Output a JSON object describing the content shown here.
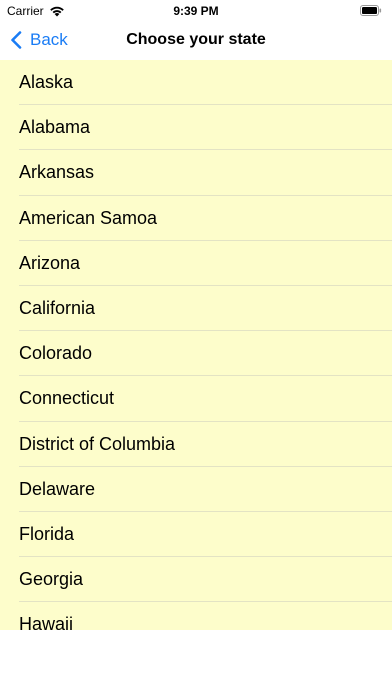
{
  "status_bar": {
    "carrier": "Carrier",
    "time": "9:39 PM",
    "wifi_icon": "wifi-icon",
    "battery_icon": "battery-icon"
  },
  "nav": {
    "back_label": "Back",
    "back_icon": "chevron-left-icon",
    "title": "Choose your state"
  },
  "colors": {
    "accent": "#1a7cf5",
    "list_background": "#fdfdcb"
  },
  "states": [
    "Alaska",
    "Alabama",
    "Arkansas",
    "American Samoa",
    "Arizona",
    "California",
    "Colorado",
    "Connecticut",
    "District of Columbia",
    "Delaware",
    "Florida",
    "Georgia",
    "Hawaii"
  ]
}
